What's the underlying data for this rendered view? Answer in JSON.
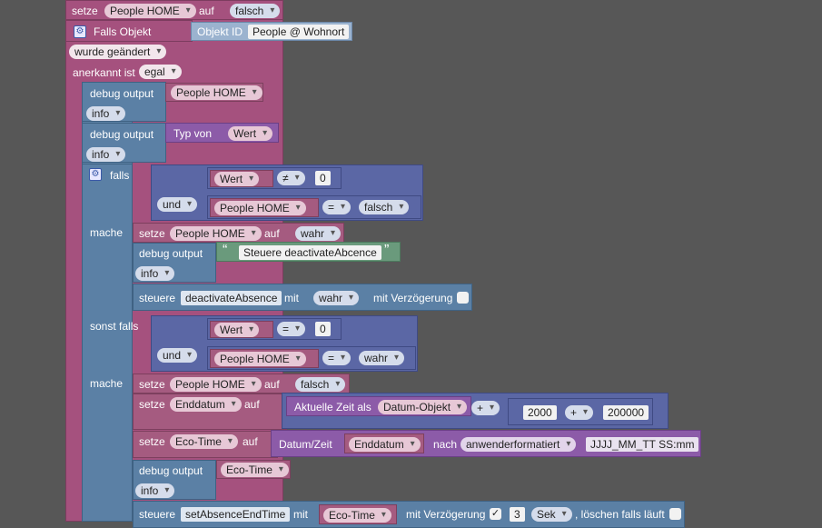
{
  "trigger": {
    "set_label": "setze",
    "set_var": "People HOME",
    "auf": "auf",
    "set_value": "falsch",
    "if_object": "Falls Objekt",
    "object_id_label": "Objekt ID",
    "object_id": "People @ Wohnort",
    "changed": "wurde geändert",
    "ack_label": "anerkannt ist",
    "ack_value": "egal"
  },
  "debug1": {
    "label": "debug output",
    "var": "People HOME",
    "level": "info"
  },
  "debug2": {
    "label": "debug output",
    "typeof": "Typ von",
    "var": "Wert",
    "level": "info"
  },
  "if_block": {
    "falls": "falls",
    "cond1": {
      "left": "Wert",
      "op": "≠",
      "right": "0"
    },
    "und": "und",
    "cond2": {
      "left": "People HOME",
      "op": "=",
      "right": "falsch"
    },
    "mache": "mache",
    "set1": {
      "label": "setze",
      "var": "People HOME",
      "auf": "auf",
      "value": "wahr"
    },
    "debug3": {
      "label": "debug output",
      "quote_open": "“",
      "text": "Steuere deactivateAbcence",
      "quote_close": "”",
      "level": "info"
    },
    "control1": {
      "label": "steuere",
      "target": "deactivateAbsence",
      "mit": "mit",
      "value": "wahr",
      "delay": "mit Verzögerung"
    },
    "elseif": "sonst falls",
    "cond3": {
      "left": "Wert",
      "op": "=",
      "right": "0"
    },
    "und2": "und",
    "cond4": {
      "left": "People HOME",
      "op": "=",
      "right": "wahr"
    },
    "mache2": "mache",
    "set2": {
      "label": "setze",
      "var": "People HOME",
      "auf": "auf",
      "value": "falsch"
    },
    "set3": {
      "label": "setze",
      "var": "Enddatum",
      "auf": "auf",
      "time_label": "Aktuelle Zeit als",
      "time_format": "Datum-Objekt",
      "plus": "+",
      "num1": "2000",
      "plus2": "+",
      "num2": "200000"
    },
    "set4": {
      "label": "setze",
      "var": "Eco-Time",
      "auf": "auf",
      "datetime": "Datum/Zeit",
      "src": "Enddatum",
      "nach": "nach",
      "format_sel": "anwenderformatiert",
      "format": "JJJJ_MM_TT SS:mm"
    },
    "debug4": {
      "label": "debug output",
      "var": "Eco-Time",
      "level": "info"
    },
    "control2": {
      "label": "steuere",
      "target": "setAbsenceEndTime",
      "mit": "mit",
      "value": "Eco-Time",
      "delay": "mit Verzögerung",
      "check": "✓",
      "amount": "3",
      "unit": "Sek",
      "clear": ", löschen falls läuft"
    }
  },
  "colors": {
    "trigger": "#a5517e",
    "control": "#5b80a5",
    "variable": "#a55b80",
    "compare": "#5b67a5",
    "string": "#6a9a7c",
    "date": "#8c5ba8",
    "workspace": "#575757"
  }
}
